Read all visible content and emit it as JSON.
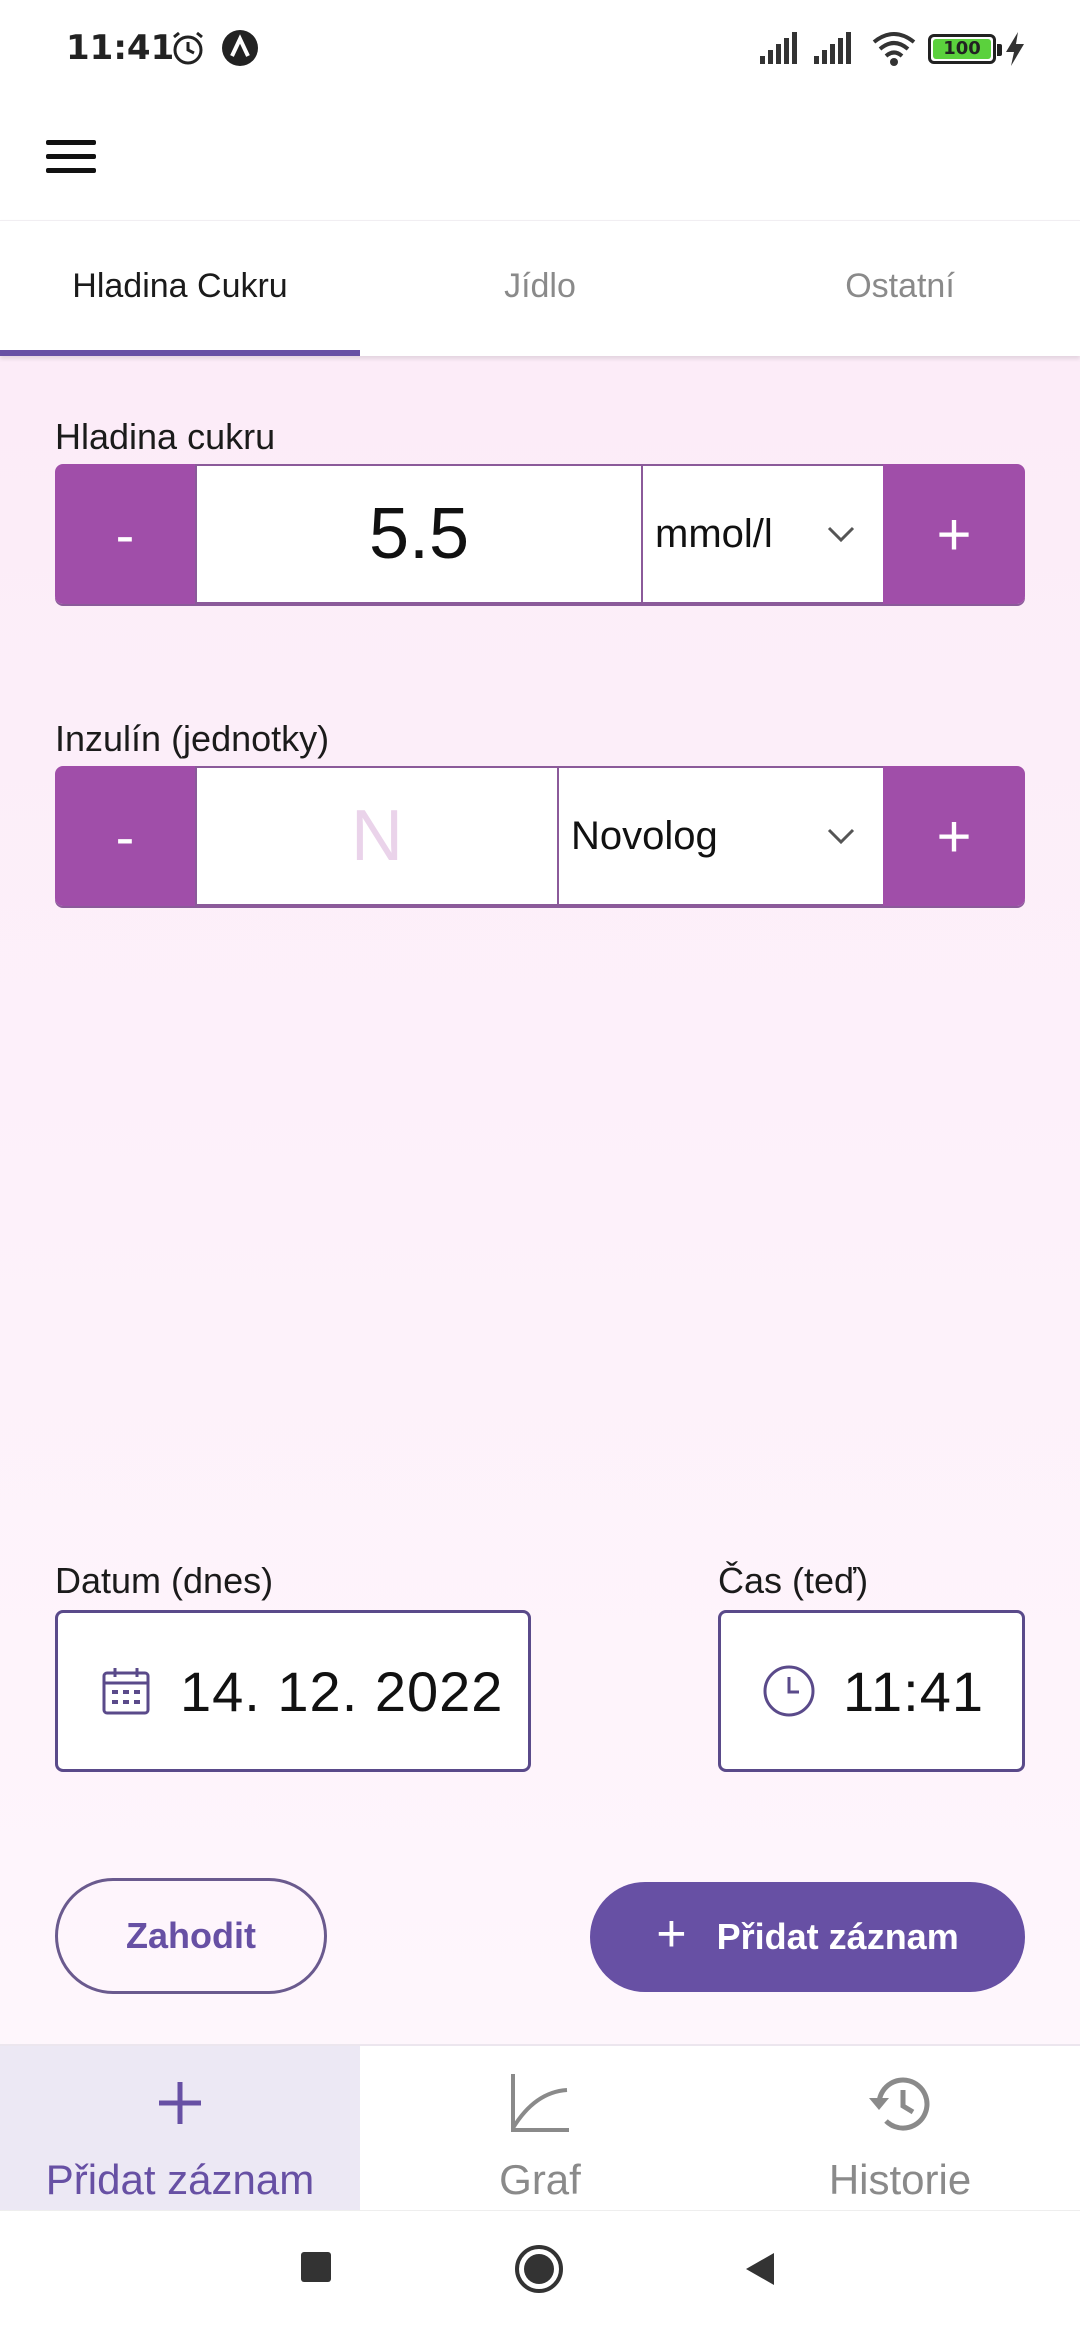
{
  "status_bar": {
    "time": "11:41",
    "battery": "100"
  },
  "tabs": [
    {
      "label": "Hladina Cukru",
      "active": true
    },
    {
      "label": "Jídlo",
      "active": false
    },
    {
      "label": "Ostatní",
      "active": false
    }
  ],
  "glucose": {
    "label": "Hladina cukru",
    "minus": "-",
    "value": "5.5",
    "unit": "mmol/l",
    "plus": "+"
  },
  "insulin": {
    "label": "Inzulín (jednotky)",
    "minus": "-",
    "placeholder": "N",
    "type": "Novolog",
    "plus": "+"
  },
  "date": {
    "label": "Datum (dnes)",
    "value": "14. 12. 2022"
  },
  "time": {
    "label": "Čas (teď)",
    "value": "11:41"
  },
  "actions": {
    "discard": "Zahodit",
    "add": "Přidat záznam",
    "add_icon": "+"
  },
  "bottom_nav": [
    {
      "label": "Přidat záznam",
      "icon": "plus-icon",
      "active": true
    },
    {
      "label": "Graf",
      "icon": "chart-icon",
      "active": false
    },
    {
      "label": "Historie",
      "icon": "history-icon",
      "active": false
    }
  ],
  "colors": {
    "primary": "#6750a4",
    "stepper": "#a04ea9",
    "background": "#fcecf8"
  }
}
